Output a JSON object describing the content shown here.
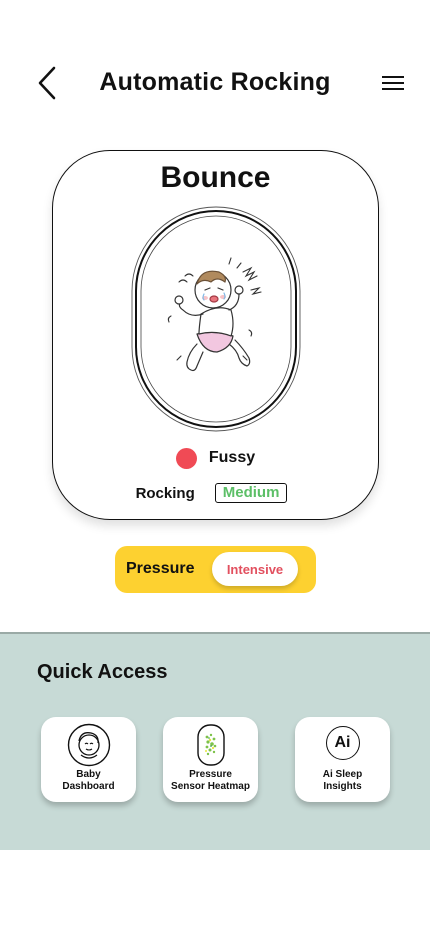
{
  "header": {
    "title": "Automatic Rocking",
    "back_icon": "chevron-left-icon",
    "menu_icon": "hamburger-menu-icon"
  },
  "card": {
    "mode": "Bounce",
    "status": {
      "label": "Fussy",
      "color": "#f04a55"
    },
    "rocking": {
      "label": "Rocking",
      "value": "Medium",
      "value_color": "#5cbf67"
    }
  },
  "pressure": {
    "label": "Pressure",
    "value": "Intensive",
    "background": "#fdd130",
    "value_color": "#e2505f"
  },
  "quick_access": {
    "title": "Quick Access",
    "background": "#c7dad6",
    "items": [
      {
        "label": "Baby\nDashboard",
        "icon": "baby-face-icon"
      },
      {
        "label": "Pressure\nSensor Heatmap",
        "icon": "heatmap-mattress-icon"
      },
      {
        "label": "Ai Sleep\nInsights",
        "icon": "ai-icon",
        "icon_text": "Ai"
      }
    ]
  }
}
